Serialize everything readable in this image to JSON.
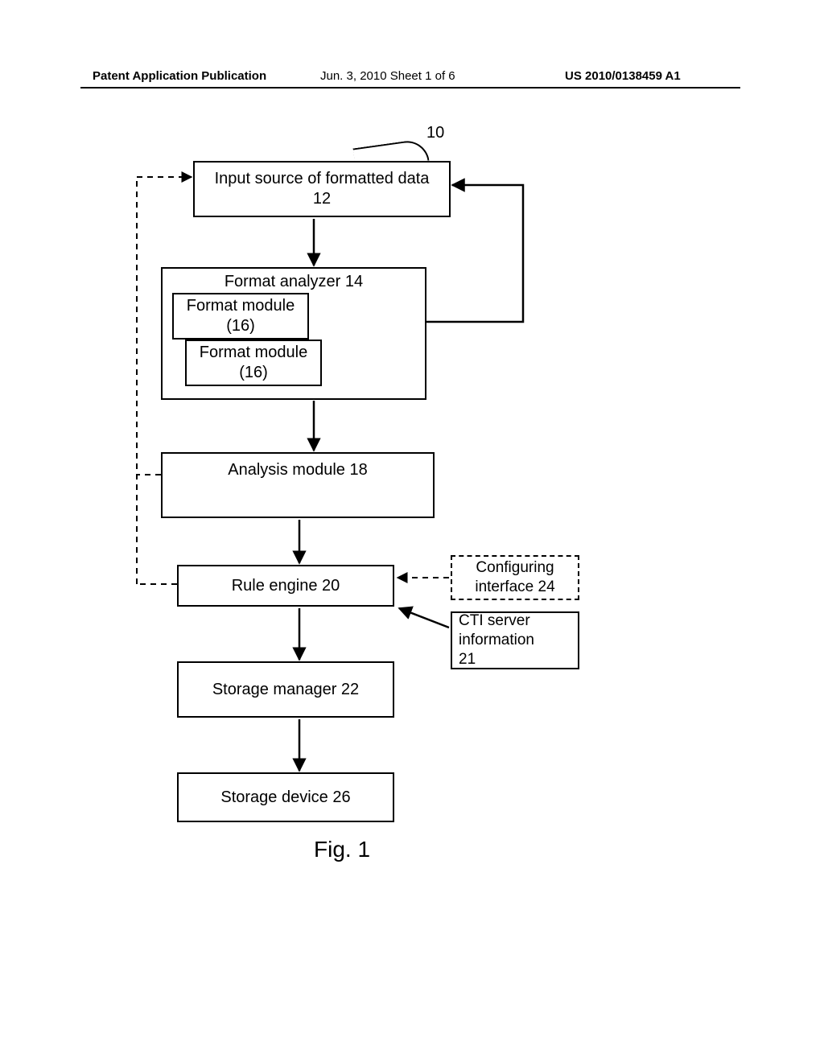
{
  "header": {
    "left": "Patent Application Publication",
    "center": "Jun. 3, 2010  Sheet 1 of 6",
    "right": "US 2010/0138459 A1"
  },
  "labels": {
    "ref10": "10"
  },
  "boxes": {
    "b12": {
      "line1": "Input source of formatted data",
      "line2": "12"
    },
    "b14": {
      "title": "Format analyzer 14"
    },
    "b16a": {
      "line1": "Format module",
      "line2": "(16)"
    },
    "b16b": {
      "line1": "Format module",
      "line2": "(16)"
    },
    "b18": {
      "title": "Analysis module 18"
    },
    "b20": {
      "title": "Rule engine 20"
    },
    "b22": {
      "title": "Storage manager 22"
    },
    "b26": {
      "title": "Storage device 26"
    },
    "b24": {
      "line1": "Configuring",
      "line2": "interface  24"
    },
    "b21": {
      "line1": "CTI server",
      "line2": "information",
      "line3": "21"
    }
  },
  "figure_caption": "Fig. 1"
}
